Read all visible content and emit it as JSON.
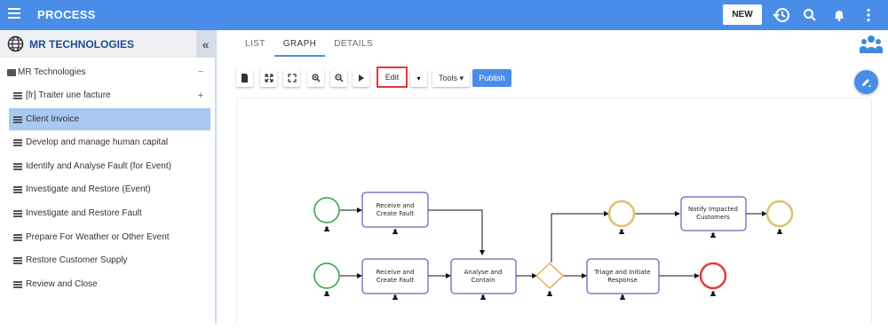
{
  "header": {
    "title": "PROCESS",
    "new_label": "NEW",
    "icons": [
      "menu-icon",
      "history-icon",
      "search-icon",
      "bell-icon",
      "more-vertical-icon"
    ]
  },
  "sidebar": {
    "org_title": "MR TECHNOLOGIES",
    "collapse_symbol": "«",
    "root": {
      "label": "MR Technologies",
      "toggle": "−"
    },
    "items": [
      {
        "label": "[fr] Traiter une facture",
        "toggle": "+"
      },
      {
        "label": "Client Invoice",
        "selected": true
      },
      {
        "label": "Develop and manage human capital"
      },
      {
        "label": "Identify and Analyse Fault (for Event)"
      },
      {
        "label": "Investigate and Restore (Event)"
      },
      {
        "label": "Investigate and Restore Fault"
      },
      {
        "label": "Prepare For Weather or Other Event"
      },
      {
        "label": "Restore Customer Supply"
      },
      {
        "label": "Review and Close"
      }
    ]
  },
  "tabs": [
    {
      "label": "LIST"
    },
    {
      "label": "GRAPH",
      "active": true
    },
    {
      "label": "DETAILS"
    }
  ],
  "toolbar": {
    "edit_label": "Edit",
    "dropdown_symbol": "▾",
    "tools_label": "Tools ▾",
    "publish_label": "Publish"
  },
  "diagram": {
    "tasks": {
      "t1a": "Receive and",
      "t1b": "Create Fault",
      "t2a": "Receive and",
      "t2b": "Create Fault",
      "t3a": "Analyse and",
      "t3b": "Contain",
      "t4a": "Triage and Initiate",
      "t4b": "Response",
      "t5a": "Notify Impacted",
      "t5b": "Customers"
    }
  },
  "colors": {
    "accent": "#4a8de8",
    "start_event": "#2e9e3a",
    "intermediate_event": "#e0c070",
    "end_event": "#e53935",
    "task_border": "#3f3aa0",
    "gateway": "#f0a030",
    "selected_row": "#a8c8f2"
  }
}
